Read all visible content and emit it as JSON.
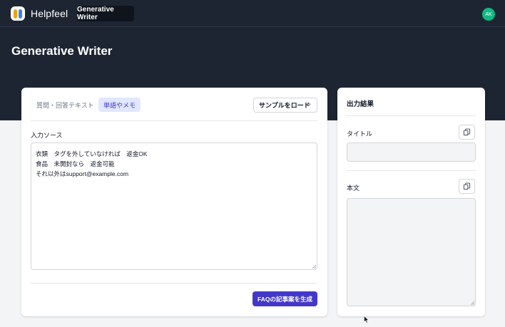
{
  "header": {
    "brand": "Helpfeel",
    "nav_tab": "Generative Writer",
    "avatar_initials": "AK"
  },
  "page": {
    "title": "Generative Writer"
  },
  "input_panel": {
    "tabs": [
      {
        "label": "質問・回答テキスト",
        "active": false
      },
      {
        "label": "単語やメモ",
        "active": true
      }
    ],
    "sample_button": "サンプルをロード",
    "source_label": "入力ソース",
    "source_lines": [
      "衣類　タグを外していなければ　返金OK",
      "食品　未開封なら　返金可能",
      "それ以外はsupport@example.com"
    ],
    "generate_button": "FAQの記事案を生成"
  },
  "output_panel": {
    "heading": "出力結果",
    "title_label": "タイトル",
    "title_value": "",
    "body_label": "本文",
    "body_value": ""
  },
  "icons": {
    "copy": "copy-icon",
    "chevron": "chevron-down-icon",
    "cursor": "mouse-pointer-icon"
  },
  "colors": {
    "header_bg": "#1e2532",
    "primary": "#4338ca",
    "active_tab_bg": "#e0e7ff",
    "avatar": "#10b981"
  }
}
